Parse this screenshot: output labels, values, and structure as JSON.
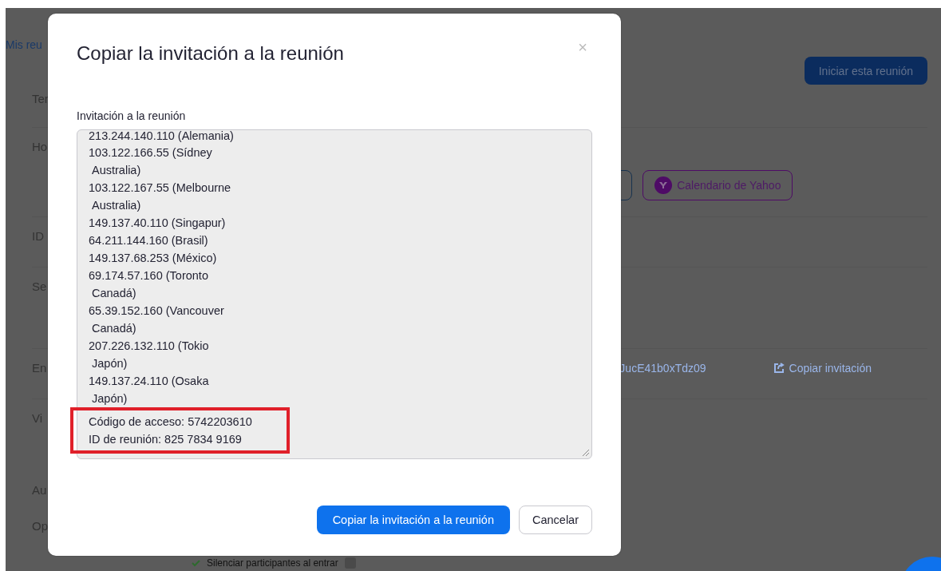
{
  "background_page": {
    "breadcrumb": "Mis reu",
    "start_button": "Iniciar esta reunión",
    "rows": [
      {
        "label": "Ter",
        "kind": "plain"
      },
      {
        "label": "Ho",
        "kind": "calendar",
        "yahoo_button": "Calendario de Yahoo"
      },
      {
        "label": "ID",
        "kind": "plain"
      },
      {
        "label": "Se",
        "kind": "plain"
      },
      {
        "label": "En",
        "kind": "link",
        "link": "JucE41b0xTdz09",
        "copy_link": "Copiar invitación"
      },
      {
        "label": "Vi",
        "kind": "plain"
      },
      {
        "label": "Au",
        "kind": "plain"
      },
      {
        "label": "Op",
        "kind": "option",
        "option": "Silenciar participantes al entrar",
        "checked": true
      }
    ]
  },
  "dialog": {
    "title": "Copiar la invitación a la reunión",
    "close": "×",
    "field_label": "Invitación a la reunión",
    "lines": [
      {
        "text": "213.244.140.110 (Alemania)",
        "kind": "cut"
      },
      {
        "text": "103.122.166.55 (Sídney",
        "kind": "line"
      },
      {
        "text": "Australia)",
        "kind": "continuation"
      },
      {
        "text": "103.122.167.55 (Melbourne",
        "kind": "line"
      },
      {
        "text": "Australia)",
        "kind": "continuation"
      },
      {
        "text": "149.137.40.110 (Singapur)",
        "kind": "line"
      },
      {
        "text": "64.211.144.160 (Brasil)",
        "kind": "line"
      },
      {
        "text": "149.137.68.253 (México)",
        "kind": "line"
      },
      {
        "text": "69.174.57.160 (Toronto",
        "kind": "line"
      },
      {
        "text": "Canadá)",
        "kind": "continuation"
      },
      {
        "text": "65.39.152.160 (Vancouver",
        "kind": "line"
      },
      {
        "text": "Canadá)",
        "kind": "continuation"
      },
      {
        "text": "207.226.132.110 (Tokio",
        "kind": "line"
      },
      {
        "text": "Japón)",
        "kind": "continuation"
      },
      {
        "text": "149.137.24.110 (Osaka",
        "kind": "line"
      },
      {
        "text": "Japón)",
        "kind": "continuation"
      }
    ],
    "highlighted_lines": [
      "Código de acceso: 5742203610",
      "ID de reunión: 825 7834 9169"
    ],
    "buttons": [
      {
        "label": "Copiar la invitación a la reunión",
        "kind": "primary"
      },
      {
        "label": "Cancelar",
        "kind": "secondary"
      }
    ]
  }
}
